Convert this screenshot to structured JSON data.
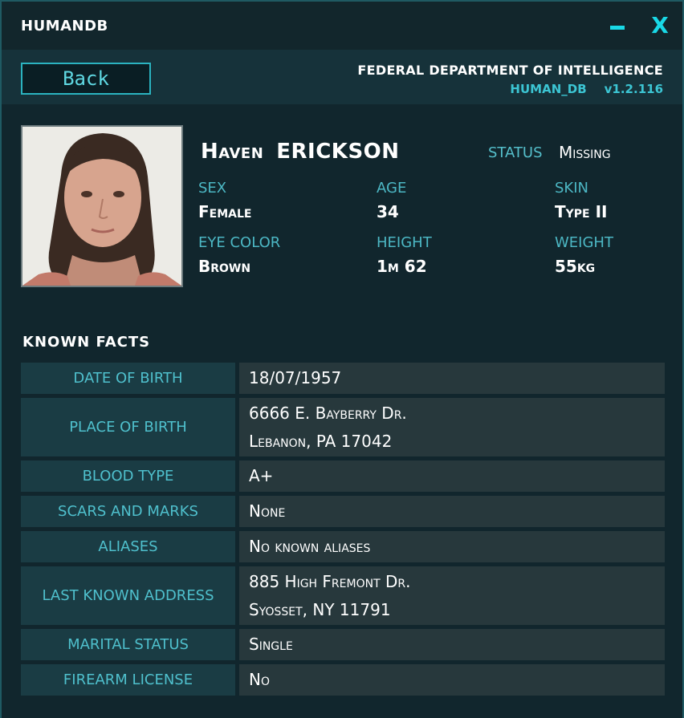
{
  "window": {
    "title": "HUMANDB",
    "minimize_glyph": "",
    "close_glyph": "X"
  },
  "header": {
    "back_label": "Back",
    "agency": "FEDERAL DEPARTMENT OF INTELLIGENCE",
    "db_name": "HUMAN_DB",
    "version": "v1.2.116"
  },
  "profile": {
    "first_name": "Haven",
    "last_name": "ERICKSON",
    "status_label": "STATUS",
    "status_value": "Missing",
    "attributes": [
      {
        "label": "SEX",
        "value": "Female"
      },
      {
        "label": "AGE",
        "value": "34"
      },
      {
        "label": "SKIN",
        "value": "Type II"
      },
      {
        "label": "EYE COLOR",
        "value": "Brown"
      },
      {
        "label": "HEIGHT",
        "value": "1m 62"
      },
      {
        "label": "WEIGHT",
        "value": "55kg"
      }
    ]
  },
  "facts": {
    "title": "KNOWN  FACTS",
    "rows": [
      {
        "label": "DATE OF BIRTH",
        "lines": [
          "18/07/1957"
        ]
      },
      {
        "label": "PLACE OF BIRTH",
        "lines": [
          "6666 E. Bayberry Dr.",
          "Lebanon, PA 17042"
        ]
      },
      {
        "label": "BLOOD TYPE",
        "lines": [
          "A+"
        ]
      },
      {
        "label": "SCARS AND MARKS",
        "lines": [
          "None"
        ]
      },
      {
        "label": "ALIASES",
        "lines": [
          "No known aliases"
        ]
      },
      {
        "label": "LAST KNOWN ADDRESS",
        "lines": [
          "885 High Fremont Dr.",
          "Syosset, NY 11791"
        ]
      },
      {
        "label": "MARITAL STATUS",
        "lines": [
          "Single"
        ]
      },
      {
        "label": "FIREARM LICENSE",
        "lines": [
          "No"
        ]
      }
    ]
  },
  "colors": {
    "accent": "#19d8e6",
    "label": "#4cb7c4",
    "background": "#11262d"
  },
  "icons": {
    "minimize": "minimize-icon",
    "close": "close-icon"
  }
}
